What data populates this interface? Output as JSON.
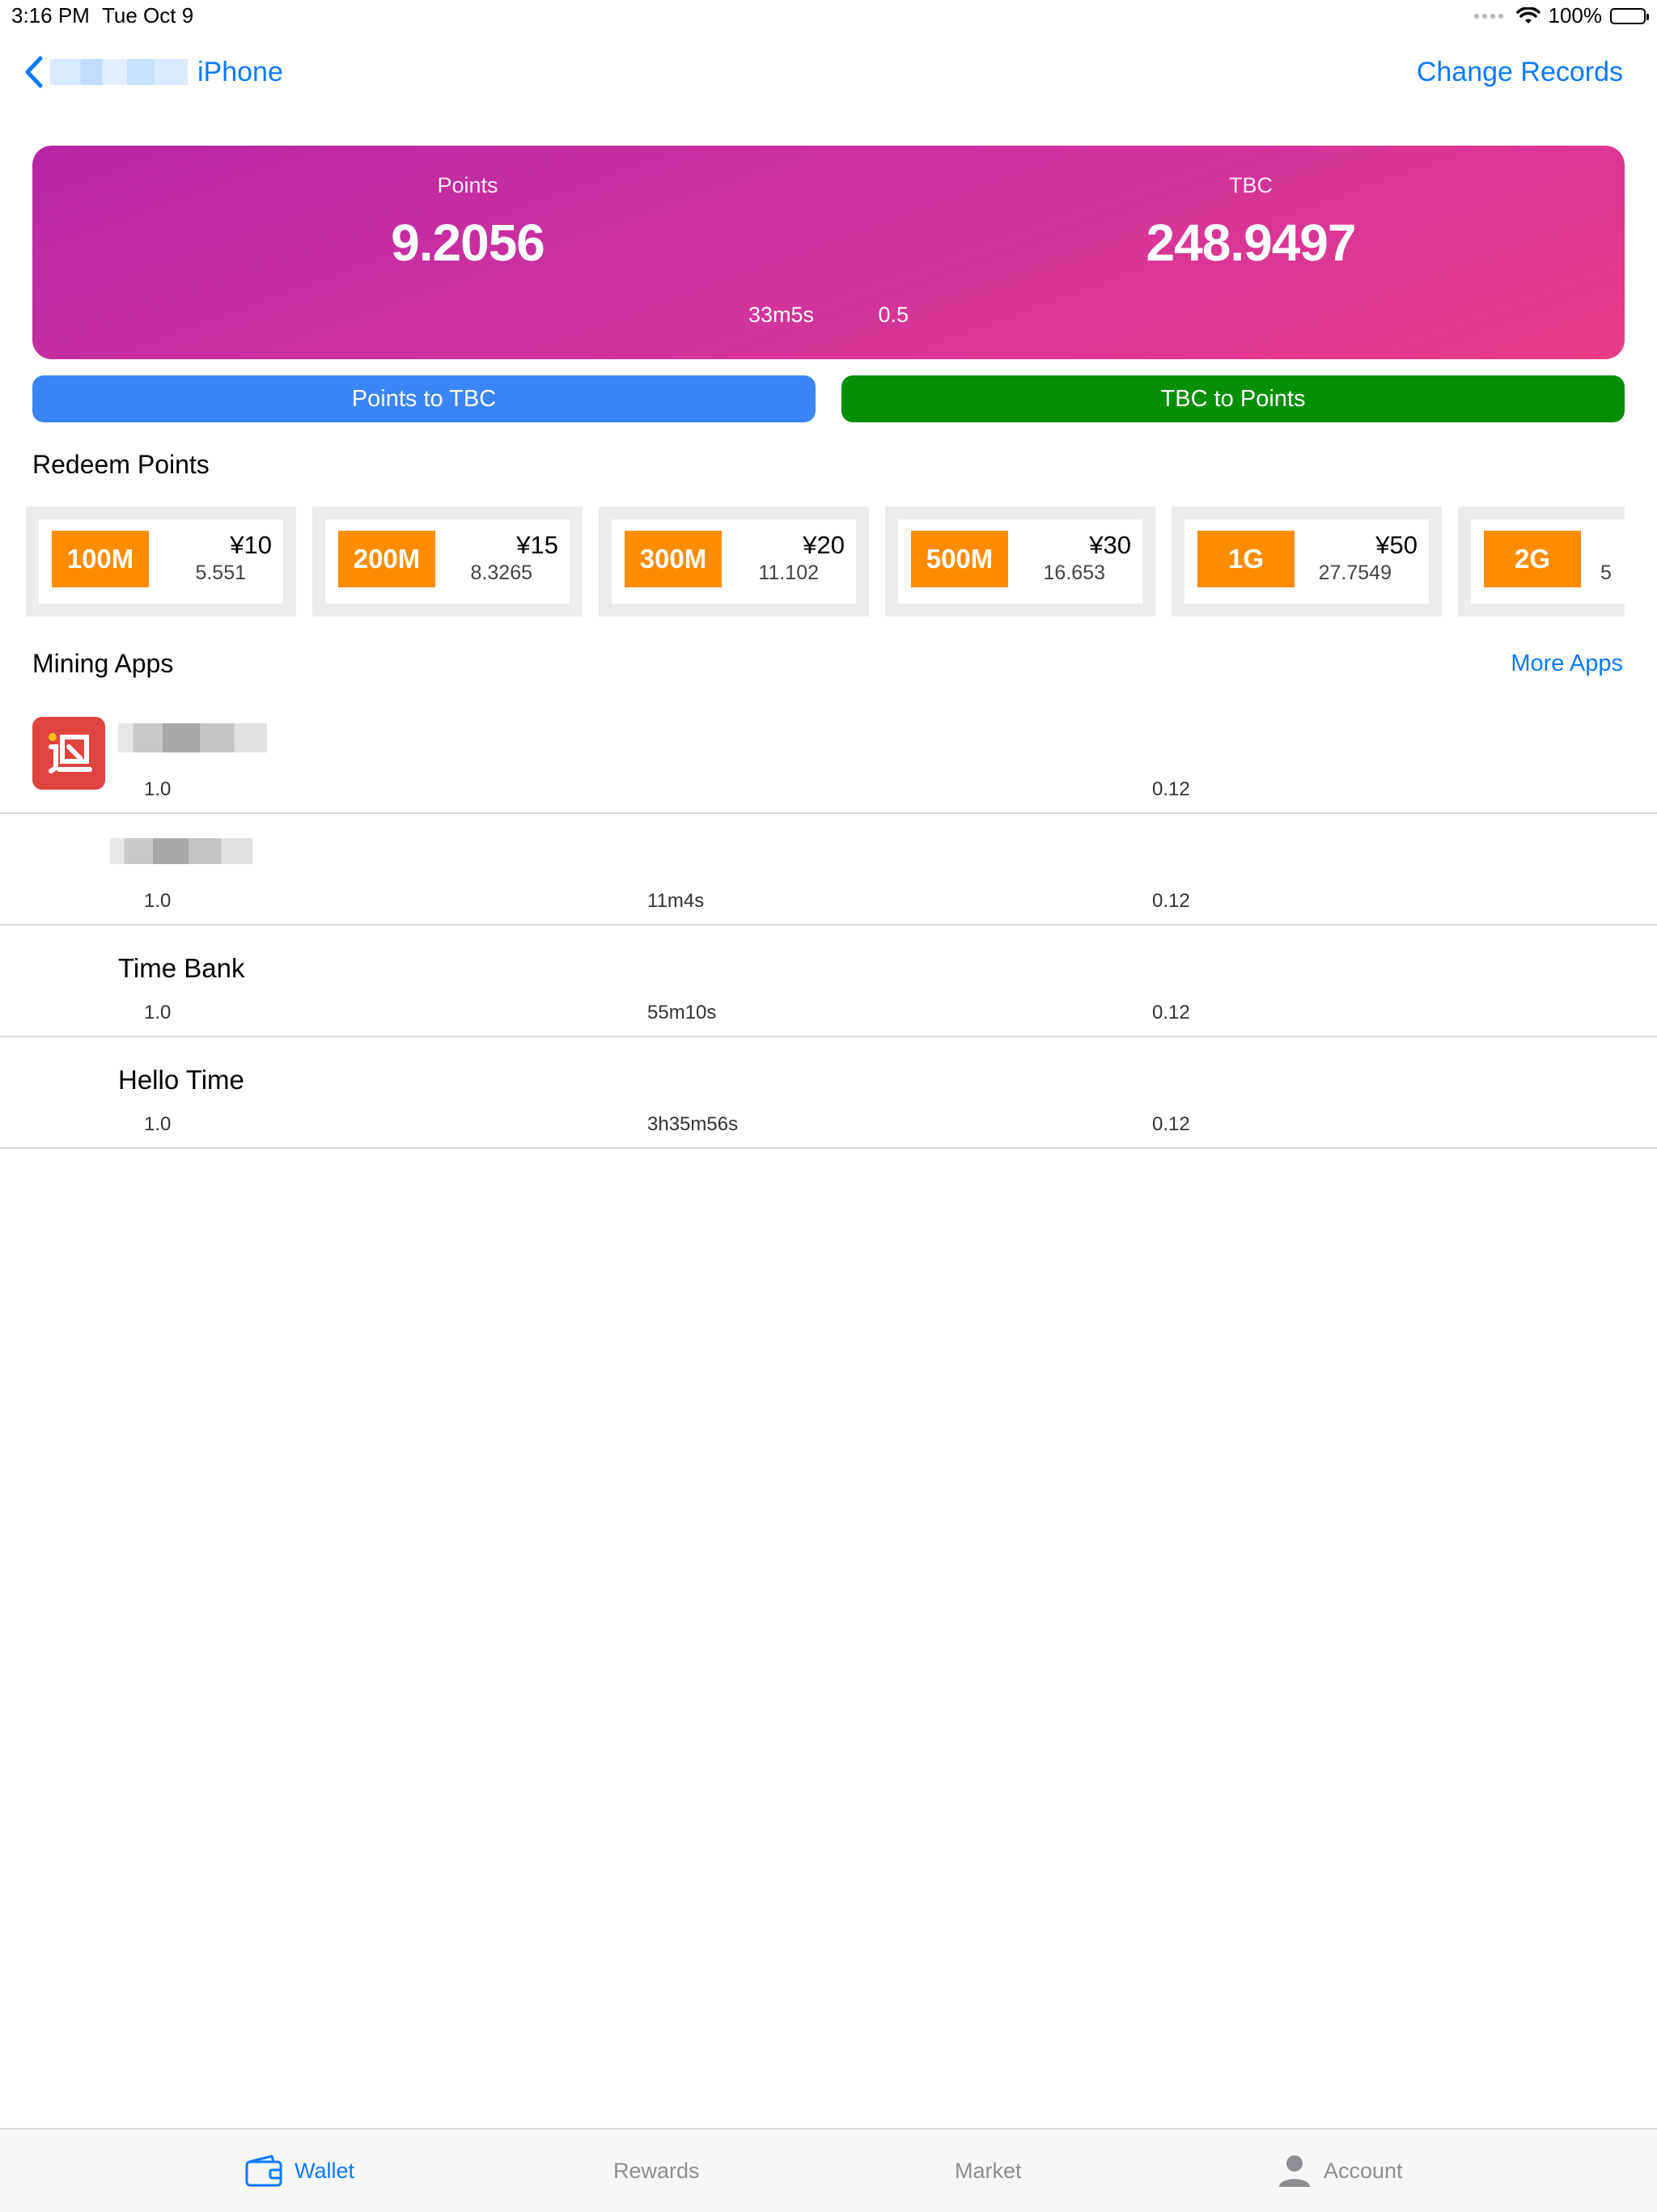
{
  "status": {
    "time": "3:16 PM",
    "date": "Tue Oct 9",
    "battery": "100%"
  },
  "nav": {
    "back_label": "iPhone",
    "right_action": "Change Records"
  },
  "balance": {
    "points_label": "Points",
    "points_value": "9.2056",
    "tbc_label": "TBC",
    "tbc_value": "248.9497",
    "meta1": "33m5s",
    "meta2": "0.5"
  },
  "buttons": {
    "points_to_tbc": "Points to TBC",
    "tbc_to_points": "TBC to Points"
  },
  "redeem": {
    "title": "Redeem Points",
    "items": [
      {
        "amount": "100M",
        "price": "¥10",
        "points": "5.551"
      },
      {
        "amount": "200M",
        "price": "¥15",
        "points": "8.3265"
      },
      {
        "amount": "300M",
        "price": "¥20",
        "points": "11.102"
      },
      {
        "amount": "500M",
        "price": "¥30",
        "points": "16.653"
      },
      {
        "amount": "1G",
        "price": "¥50",
        "points": "27.7549"
      },
      {
        "amount": "2G",
        "price": "",
        "points": "5"
      }
    ]
  },
  "mining": {
    "title": "Mining Apps",
    "more": "More Apps",
    "apps": [
      {
        "name": "",
        "c1": "1.0",
        "c2": "",
        "c3": "0.12"
      },
      {
        "name": "",
        "c1": "1.0",
        "c2": "11m4s",
        "c3": "0.12"
      },
      {
        "name": "Time Bank",
        "c1": "1.0",
        "c2": "55m10s",
        "c3": "0.12"
      },
      {
        "name": "Hello Time",
        "c1": "1.0",
        "c2": "3h35m56s",
        "c3": "0.12"
      }
    ]
  },
  "tabs": {
    "wallet": "Wallet",
    "rewards": "Rewards",
    "market": "Market",
    "account": "Account"
  },
  "colors": {
    "accent": "#0a7aff",
    "orange": "#fd8c00",
    "green": "#048f05",
    "blue_button": "#3a86f8",
    "card_from": "#b526a6",
    "card_to": "#ea3b86"
  }
}
